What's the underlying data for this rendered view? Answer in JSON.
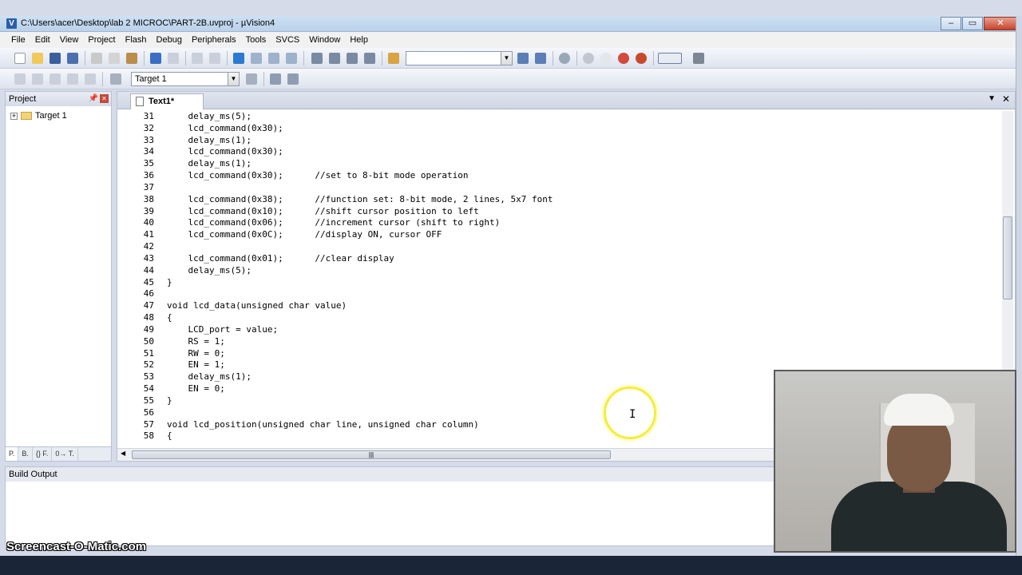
{
  "window": {
    "title": "C:\\Users\\acer\\Desktop\\lab 2 MICROC\\PART-2B.uvproj - µVision4",
    "app_icon_letter": "V",
    "controls": {
      "minimize": "–",
      "maximize": "▭",
      "close": "✕"
    }
  },
  "menu": [
    "File",
    "Edit",
    "View",
    "Project",
    "Flash",
    "Debug",
    "Peripherals",
    "Tools",
    "SVCS",
    "Window",
    "Help"
  ],
  "toolbar2": {
    "target_select": "Target 1"
  },
  "project_pane": {
    "title": "Project",
    "tree_root": "Target 1",
    "tabs": [
      "P.",
      "B.",
      "{} F.",
      "0→ T."
    ]
  },
  "editor": {
    "tab_label": "Text1*",
    "lines": [
      {
        "n": "31",
        "t": "    delay_ms(5);"
      },
      {
        "n": "32",
        "t": "    lcd_command(0x30);"
      },
      {
        "n": "33",
        "t": "    delay_ms(1);"
      },
      {
        "n": "34",
        "t": "    lcd_command(0x30);"
      },
      {
        "n": "35",
        "t": "    delay_ms(1);"
      },
      {
        "n": "36",
        "t": "    lcd_command(0x30);      //set to 8-bit mode operation"
      },
      {
        "n": "37",
        "t": ""
      },
      {
        "n": "38",
        "t": "    lcd_command(0x38);      //function set: 8-bit mode, 2 lines, 5x7 font"
      },
      {
        "n": "39",
        "t": "    lcd_command(0x10);      //shift cursor position to left"
      },
      {
        "n": "40",
        "t": "    lcd_command(0x06);      //increment cursor (shift to right)"
      },
      {
        "n": "41",
        "t": "    lcd_command(0x0C);      //display ON, cursor OFF"
      },
      {
        "n": "42",
        "t": ""
      },
      {
        "n": "43",
        "t": "    lcd_command(0x01);      //clear display"
      },
      {
        "n": "44",
        "t": "    delay_ms(5);"
      },
      {
        "n": "45",
        "t": "}"
      },
      {
        "n": "46",
        "t": ""
      },
      {
        "n": "47",
        "t": "void lcd_data(unsigned char value)"
      },
      {
        "n": "48",
        "t": "{"
      },
      {
        "n": "49",
        "t": "    LCD_port = value;"
      },
      {
        "n": "50",
        "t": "    RS = 1;"
      },
      {
        "n": "51",
        "t": "    RW = 0;"
      },
      {
        "n": "52",
        "t": "    EN = 1;"
      },
      {
        "n": "53",
        "t": "    delay_ms(1);"
      },
      {
        "n": "54",
        "t": "    EN = 0;"
      },
      {
        "n": "55",
        "t": "}"
      },
      {
        "n": "56",
        "t": ""
      },
      {
        "n": "57",
        "t": "void lcd_position(unsigned char line, unsigned char column)"
      },
      {
        "n": "58",
        "t": "{"
      }
    ]
  },
  "build_output": {
    "title": "Build Output"
  },
  "watermark": "Screencast-O-Matic.com"
}
